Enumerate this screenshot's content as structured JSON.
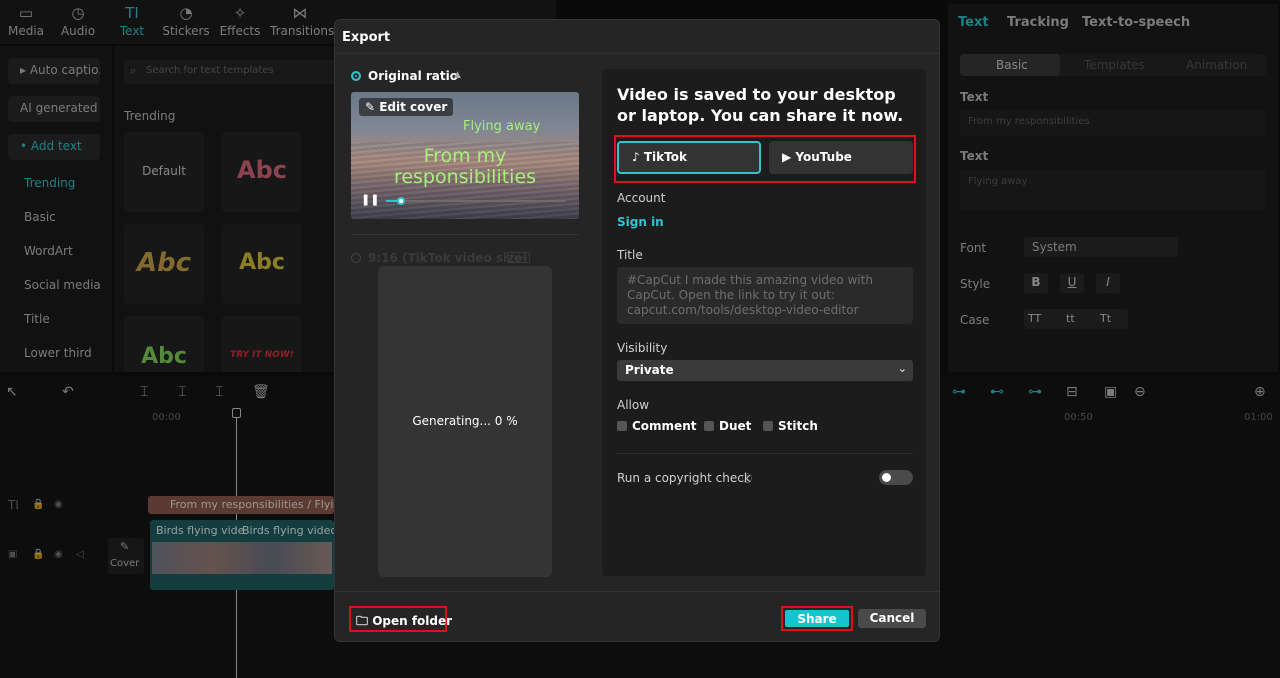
{
  "tools": [
    {
      "label": "Media",
      "icon": "media-icon"
    },
    {
      "label": "Audio",
      "icon": "audio-icon"
    },
    {
      "label": "Text",
      "icon": "text-icon"
    },
    {
      "label": "Stickers",
      "icon": "stickers-icon"
    },
    {
      "label": "Effects",
      "icon": "effects-icon"
    },
    {
      "label": "Transitions",
      "icon": "transitions-icon"
    }
  ],
  "leftnav": {
    "buttons": [
      "▸ Auto captio...",
      "AI generated",
      "• Add text"
    ],
    "items": [
      "Trending",
      "Basic",
      "WordArt",
      "Social media",
      "Title",
      "Lower third"
    ]
  },
  "library": {
    "search_placeholder": "Search for text templates",
    "section": "Trending",
    "tiles": [
      "Default",
      "Abc",
      "Abc",
      "Abc",
      "Abc",
      "TRY IT NOW!"
    ]
  },
  "right_panel": {
    "tabs": [
      "Text",
      "Tracking",
      "Text-to-speech"
    ],
    "segments": [
      "Basic",
      "Templates",
      "Animation"
    ],
    "text_label_1": "Text",
    "text_value_1": "From my responsibilities",
    "text_label_2": "Text",
    "text_value_2": "Flying away",
    "font_label": "Font",
    "font_value": "System",
    "style_label": "Style",
    "style_buttons": [
      "B",
      "U",
      "I"
    ],
    "case_label": "Case",
    "case_buttons": [
      "TT",
      "tt",
      "Tt"
    ]
  },
  "timeline": {
    "ticks": [
      "00:00",
      "00:50",
      "01:00"
    ],
    "text_clip": "From my responsibilities / Flying",
    "video_clip_1": "Birds flying vide",
    "video_clip_2": "Birds flying video.",
    "cover_label": "Cover",
    "track_label": "TI"
  },
  "dialog": {
    "title": "Export",
    "ratio_option": "Original ratio",
    "edit_cover": "Edit cover",
    "subtitle_top": "Flying away",
    "subtitle_main": "From my responsibilities",
    "tiktok_option": "9:16 (TikTok video size)",
    "free_badge": "Free",
    "generating": "Generating... 0 %",
    "progress": 0,
    "headline": "Video is saved to your desktop or laptop. You can share it now.",
    "platforms": [
      "TikTok",
      "YouTube"
    ],
    "account_label": "Account",
    "signin": "Sign in",
    "title_label": "Title",
    "title_placeholder": "#CapCut I made this amazing video with CapCut. Open the link to try it out: capcut.com/tools/desktop-video-editor",
    "visibility_label": "Visibility",
    "visibility_value": "Private",
    "allow_label": "Allow",
    "allow_options": [
      "Comment",
      "Duet",
      "Stitch"
    ],
    "copyright_label": "Run a copyright check",
    "open_folder": "Open folder",
    "share": "Share",
    "cancel": "Cancel"
  },
  "colors": {
    "accent": "#2ec5cf",
    "highlight": "#e0101a",
    "dialog_bg": "#252525"
  }
}
